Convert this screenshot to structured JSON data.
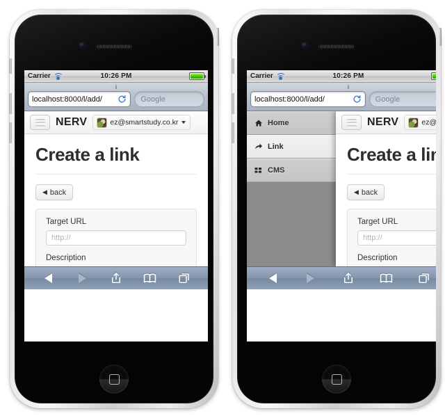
{
  "device": {
    "home_button": "home-button",
    "camera": "front-camera",
    "speaker": "earpiece-speaker"
  },
  "statusbar": {
    "carrier": "Carrier",
    "wifi_icon": "wifi-icon",
    "time": "10:26 PM",
    "battery_icon": "battery-icon",
    "battery_color": "#46c400"
  },
  "browser": {
    "page_title": "i",
    "url": "localhost:8000/l/add/",
    "reload_icon": "reload-icon",
    "search_placeholder": "Google",
    "toolbar": [
      {
        "name": "back-button",
        "icon": "triangle-left-icon",
        "enabled": true
      },
      {
        "name": "forward-button",
        "icon": "triangle-right-icon",
        "enabled": false
      },
      {
        "name": "share-button",
        "icon": "share-icon",
        "enabled": true
      },
      {
        "name": "bookmarks-button",
        "icon": "book-icon",
        "enabled": true
      },
      {
        "name": "tabs-button",
        "icon": "pages-icon",
        "enabled": true
      }
    ]
  },
  "navbar": {
    "menu_icon": "hamburger-icon",
    "brand": "NERV",
    "user": "ez@smartstudy.co.kr",
    "avatar_icon": "user-avatar",
    "caret_icon": "caret-down-icon"
  },
  "drawer": {
    "items": [
      {
        "label": "Home",
        "icon": "home-icon",
        "active": false
      },
      {
        "label": "Link",
        "icon": "arrow-share-icon",
        "active": true
      },
      {
        "label": "CMS",
        "icon": "grid-icon",
        "active": false
      }
    ],
    "background": "#8b8b8b"
  },
  "page": {
    "heading": "Create a link",
    "back_label": "back",
    "back_icon": "chevron-left-icon",
    "form": {
      "fields": [
        {
          "label": "Target URL",
          "placeholder": "http://",
          "value": ""
        },
        {
          "label": "Description",
          "placeholder": "",
          "value": ""
        }
      ]
    }
  }
}
